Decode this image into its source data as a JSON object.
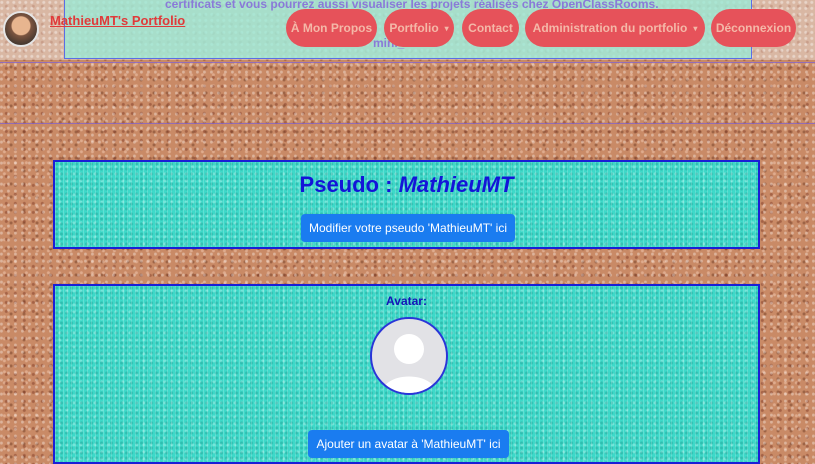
{
  "header": {
    "brand": "MathieuMT's Portfolio",
    "ghost_line_1": "certificats et vous pourrez aussi visualiser les projets réalisés chez OpenClassRooms.",
    "ghost_line_2": "mini_avatar",
    "nav": [
      {
        "label": "À Mon Propos",
        "dropdown": false
      },
      {
        "label": "Portfolio",
        "dropdown": true
      },
      {
        "label": "Contact",
        "dropdown": false
      },
      {
        "label": "Administration du portfolio",
        "dropdown": true
      },
      {
        "label": "Déconnexion",
        "dropdown": false
      }
    ],
    "colors": {
      "nav_pill": "#e6525a",
      "brand": "#e03a3a"
    }
  },
  "pseudo_card": {
    "label": "Pseudo :",
    "value": "MathieuMT",
    "button": "Modifier votre pseudo 'MathieuMT' ici"
  },
  "avatar_card": {
    "label": "Avatar:",
    "avatar_icon": "default-user-icon",
    "button": "Ajouter un avatar à 'MathieuMT' ici"
  },
  "colors": {
    "card_bg": "#3ed9c9",
    "card_border": "#1a1fd6",
    "button": "#1a7cf0",
    "title": "#1414d8"
  }
}
